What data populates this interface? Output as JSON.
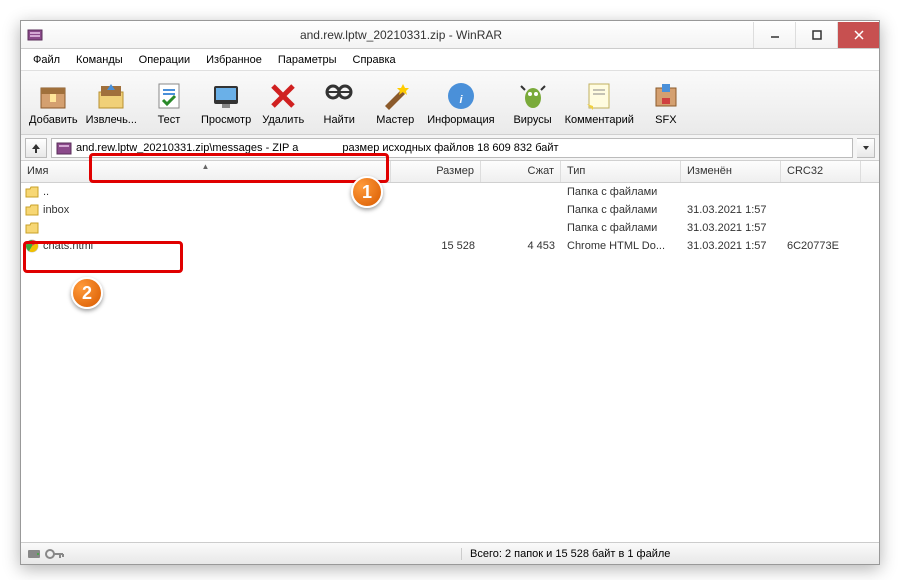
{
  "window": {
    "title": "and.rew.lptw_20210331.zip - WinRAR"
  },
  "menu": [
    "Файл",
    "Команды",
    "Операции",
    "Избранное",
    "Параметры",
    "Справка"
  ],
  "toolbar": [
    {
      "id": "add",
      "label": "Добавить"
    },
    {
      "id": "extract",
      "label": "Извлечь..."
    },
    {
      "id": "test",
      "label": "Тест"
    },
    {
      "id": "view",
      "label": "Просмотр"
    },
    {
      "id": "delete",
      "label": "Удалить"
    },
    {
      "id": "find",
      "label": "Найти"
    },
    {
      "id": "wizard",
      "label": "Мастер"
    },
    {
      "id": "info",
      "label": "Информация"
    },
    {
      "id": "virus",
      "label": "Вирусы"
    },
    {
      "id": "comment",
      "label": "Комментарий"
    },
    {
      "id": "sfx",
      "label": "SFX"
    }
  ],
  "address": {
    "path_left": "and.rew.lptw_20210331.zip\\messages - ZIP а",
    "path_right": "размер исходных файлов 18 609 832 байт"
  },
  "columns": {
    "name": "Имя",
    "size": "Размер",
    "packed": "Сжат",
    "type": "Тип",
    "mod": "Изменён",
    "crc": "CRC32"
  },
  "rows": [
    {
      "icon": "folder-up",
      "name": "..",
      "size": "",
      "packed": "",
      "type": "Папка с файлами",
      "mod": "",
      "crc": ""
    },
    {
      "icon": "folder",
      "name": "inbox",
      "size": "",
      "packed": "",
      "type": "Папка с файлами",
      "mod": "31.03.2021 1:57",
      "crc": ""
    },
    {
      "icon": "folder",
      "name": "",
      "size": "",
      "packed": "",
      "type": "Папка с файлами",
      "mod": "31.03.2021 1:57",
      "crc": ""
    },
    {
      "icon": "chrome",
      "name": "chats.html",
      "size": "15 528",
      "packed": "4 453",
      "type": "Chrome HTML Do...",
      "mod": "31.03.2021 1:57",
      "crc": "6C20773E"
    }
  ],
  "status": {
    "right": "Всего: 2 папок и 15 528 байт в 1 файле"
  },
  "annotations": {
    "badge1": "1",
    "badge2": "2"
  }
}
